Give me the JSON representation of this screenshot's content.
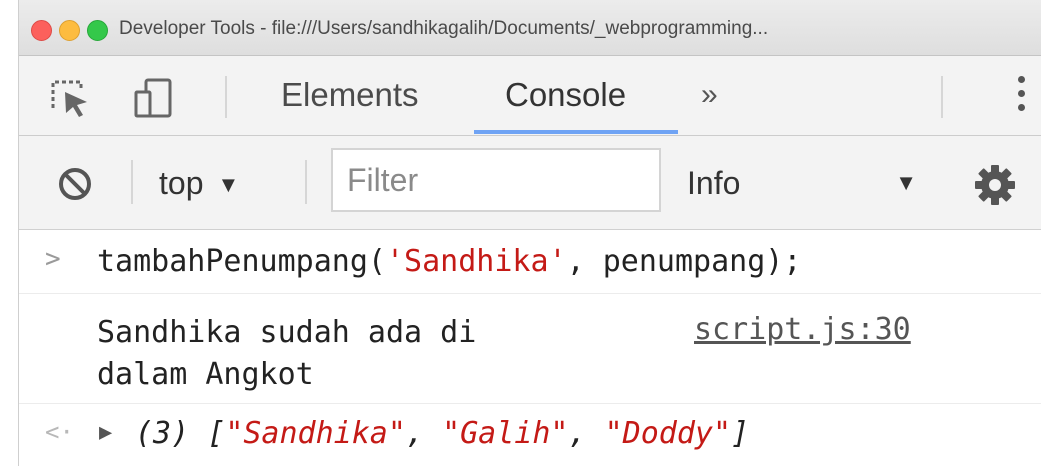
{
  "window": {
    "title": "Developer Tools - file:///Users/sandhikagalih/Documents/_webprogramming..."
  },
  "tabs": {
    "items": [
      {
        "label": "Elements"
      },
      {
        "label": "Console"
      }
    ],
    "active": "Console",
    "more_label": "»"
  },
  "console_toolbar": {
    "context_label": "top",
    "filter_placeholder": "Filter",
    "filter_value": "",
    "levels_label": "Info"
  },
  "messages": {
    "input": {
      "prompt": ">",
      "func": "tambahPenumpang(",
      "arg_string": "'Sandhika'",
      "rest": ", penumpang);"
    },
    "log": {
      "text": "Sandhika sudah ada di\ndalam Angkot",
      "source": "script.js:30"
    },
    "result": {
      "prompt": "<·",
      "expander": "▶",
      "count": "(3)",
      "open_bracket": "[",
      "items": [
        "\"Sandhika\"",
        "\"Galih\"",
        "\"Doddy\""
      ],
      "separator": ", ",
      "close_bracket": "]"
    }
  },
  "icons": [
    "inspect-element-icon",
    "device-toolbar-icon",
    "more-tabs-icon",
    "kebab-menu-icon",
    "clear-console-icon",
    "dropdown-caret-icon",
    "settings-gear-icon"
  ],
  "colors": {
    "string": "#c41a16",
    "active_tab_underline": "#6fa3f4",
    "traffic_red": "#fc605c",
    "traffic_yellow": "#fdbc40",
    "traffic_green": "#34c84a"
  }
}
